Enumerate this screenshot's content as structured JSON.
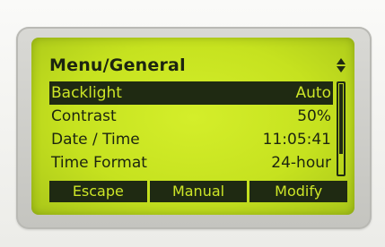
{
  "screen": {
    "title": "Menu/General",
    "scroll_icon": "up-down-arrows-icon",
    "scroll_position": 0.0
  },
  "menu": {
    "items": [
      {
        "label": "Backlight",
        "value": "Auto",
        "selected": true
      },
      {
        "label": "Contrast",
        "value": "50%",
        "selected": false
      },
      {
        "label": "Date / Time",
        "value": "11:05:41",
        "selected": false
      },
      {
        "label": "Time Format",
        "value": "24-hour",
        "selected": false
      }
    ]
  },
  "softkeys": {
    "escape": "Escape",
    "manual": "Manual",
    "modify": "Modify"
  },
  "colors": {
    "lcd_background": "#c6e21f",
    "lcd_foreground": "#1f2a12",
    "bezel": "#c4c4bf"
  }
}
